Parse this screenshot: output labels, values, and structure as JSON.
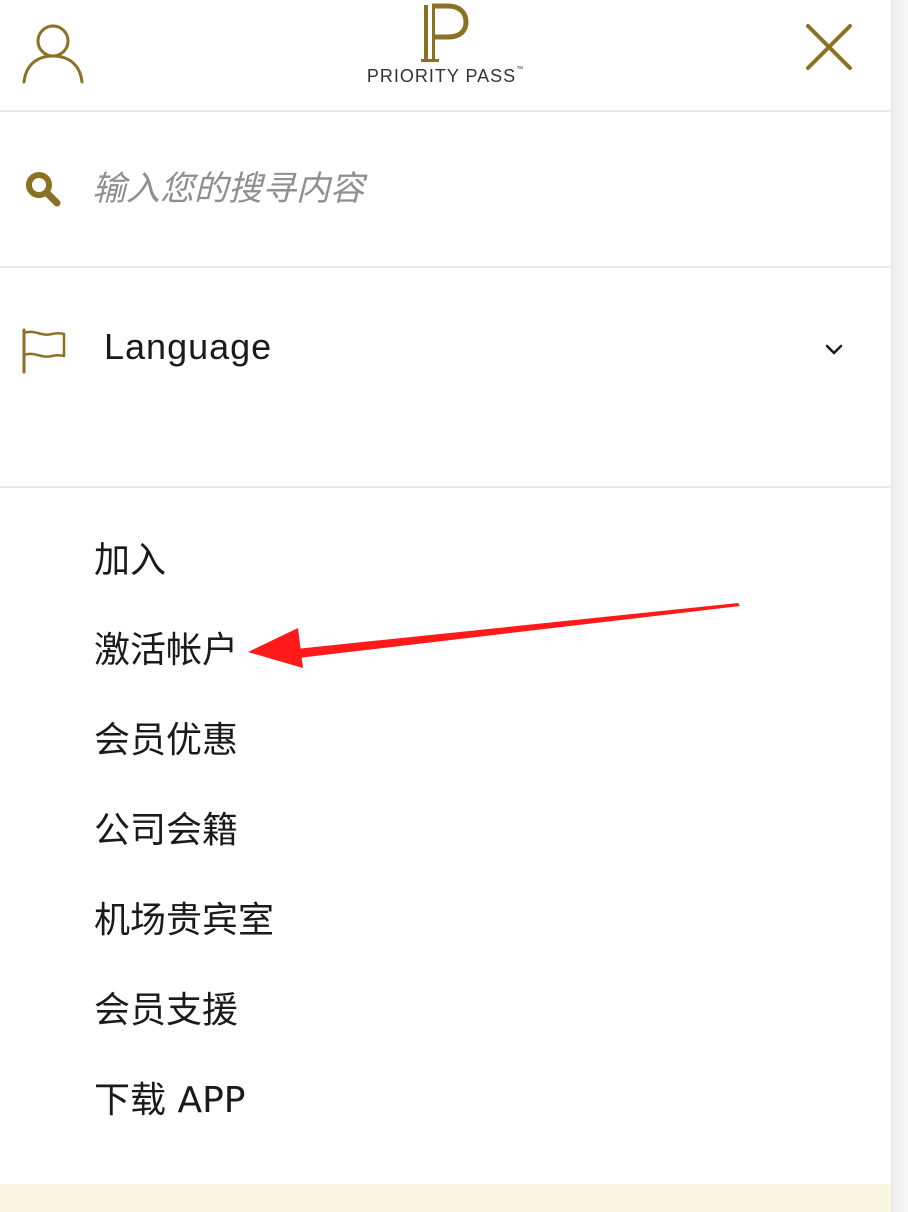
{
  "colors": {
    "accent": "#8a7124",
    "text": "#1a1a1a",
    "placeholder": "#8f8f8f",
    "divider": "#e9e9e9",
    "annotation": "#ff1a1a"
  },
  "header": {
    "brand": "PRIORITY PASS",
    "brand_mark": "™",
    "avatar_icon": "user-outline-icon",
    "close_icon": "close-icon"
  },
  "search": {
    "icon": "search-icon",
    "placeholder": "输入您的搜寻内容",
    "value": ""
  },
  "language": {
    "icon": "flag-icon",
    "label": "Language",
    "chevron": "chevron-down-icon"
  },
  "menu": {
    "items": [
      {
        "label": "加入"
      },
      {
        "label": "激活帐户"
      },
      {
        "label": "会员优惠"
      },
      {
        "label": "公司会籍"
      },
      {
        "label": "机场贵宾室"
      },
      {
        "label": "会员支援"
      },
      {
        "label": "下载 APP"
      }
    ]
  },
  "annotation": {
    "type": "arrow",
    "points_to": "激活帐户"
  }
}
